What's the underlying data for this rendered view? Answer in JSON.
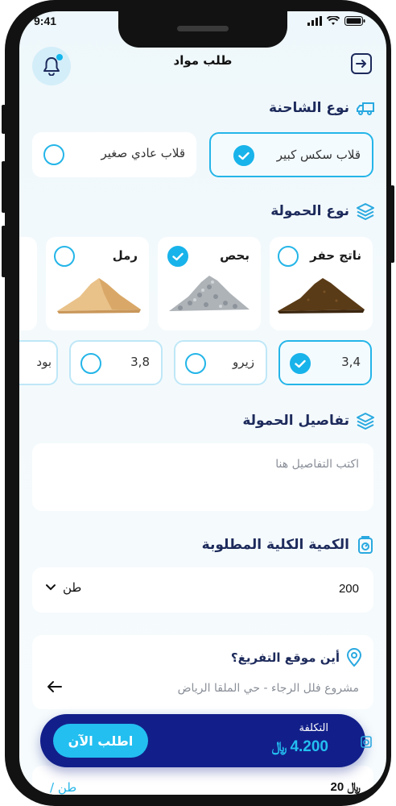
{
  "status": {
    "time": "9:41"
  },
  "header": {
    "title": "طلب مواد"
  },
  "truck_type": {
    "title": "نوع الشاحنة",
    "options": [
      {
        "label": "قلاب سكس كبير",
        "selected": true
      },
      {
        "label": "قلاب عادي صغير",
        "selected": false
      }
    ]
  },
  "load_type": {
    "title": "نوع الحمولة",
    "materials": [
      {
        "label": "ناتج حفر",
        "selected": false
      },
      {
        "label": "بحص",
        "selected": true
      },
      {
        "label": "رمل",
        "selected": false
      }
    ],
    "sizes": [
      {
        "label": "3,4",
        "selected": true
      },
      {
        "label": "زيرو",
        "selected": false
      },
      {
        "label": "3,8",
        "selected": false
      },
      {
        "label": "بود",
        "selected": false
      }
    ]
  },
  "load_details": {
    "title": "تفاصيل الحمولة",
    "placeholder": "اكتب التفاصيل هنا"
  },
  "quantity": {
    "title": "الكمية الكلية المطلوبة",
    "value": "200",
    "unit": "طن"
  },
  "unload": {
    "question": "أين موقع التفريغ؟",
    "address": "مشروع فلل الرجاء - حي الملقا الرياض"
  },
  "bottom_bar": {
    "cost_label": "التكلفة",
    "cost_value": "4.200",
    "currency_symbol": "﷼",
    "order_button": "اطلب الآن"
  },
  "partial_row": {
    "value": "20",
    "unit": "طن /"
  },
  "colors": {
    "accent": "#24b5e8",
    "navy": "#1d2a5b",
    "bar": "#121f8a"
  }
}
